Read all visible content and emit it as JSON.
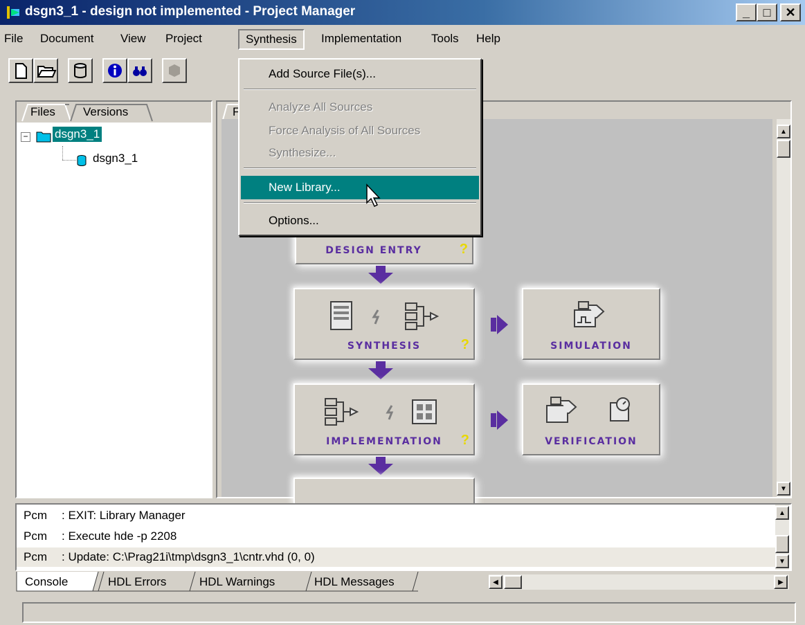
{
  "window": {
    "title": "dsgn3_1 - design not implemented - Project Manager",
    "min_label": "_",
    "max_label": "□",
    "close_label": "✕"
  },
  "menu": {
    "file": "File",
    "document": "Document",
    "view": "View",
    "project": "Project",
    "synthesis": "Synthesis",
    "implementation": "Implementation",
    "tools": "Tools",
    "help": "Help"
  },
  "left_panel": {
    "tabs": [
      "Files",
      "Versions"
    ],
    "tree": {
      "root": "dsgn3_1",
      "child": "dsgn3_1"
    }
  },
  "right_panel": {
    "tab_partial": "F"
  },
  "synthesis_menu": {
    "items": [
      {
        "label": "Add Source File(s)...",
        "enabled": true
      },
      {
        "label": "Analyze All Sources",
        "enabled": false
      },
      {
        "label": "Force Analysis of All Sources",
        "enabled": false
      },
      {
        "label": "Synthesize...",
        "enabled": false
      },
      {
        "label": "New Library...",
        "enabled": true,
        "highlighted": true
      },
      {
        "label": "Options...",
        "enabled": true
      }
    ]
  },
  "workflow": {
    "design_entry": "DESIGN ENTRY",
    "synthesis": "SYNTHESIS",
    "simulation": "SIMULATION",
    "implementation": "IMPLEMENTATION",
    "verification": "VERIFICATION",
    "help_mark": "?"
  },
  "console": {
    "lines": [
      {
        "source": "Pcm",
        "text": ": EXIT: Library Manager"
      },
      {
        "source": "Pcm",
        "text": ": Execute hde -p 2208"
      },
      {
        "source": "Pcm",
        "text": ": Update: C:\\Prag21i\\tmp\\dsgn3_1\\cntr.vhd (0, 0)"
      }
    ],
    "tabs": [
      "Console",
      "HDL Errors",
      "HDL Warnings",
      "HDL Messages"
    ]
  },
  "colors": {
    "highlight": "#008080",
    "workflow_label": "#5a2ea0",
    "help_mark": "#e8d800"
  }
}
